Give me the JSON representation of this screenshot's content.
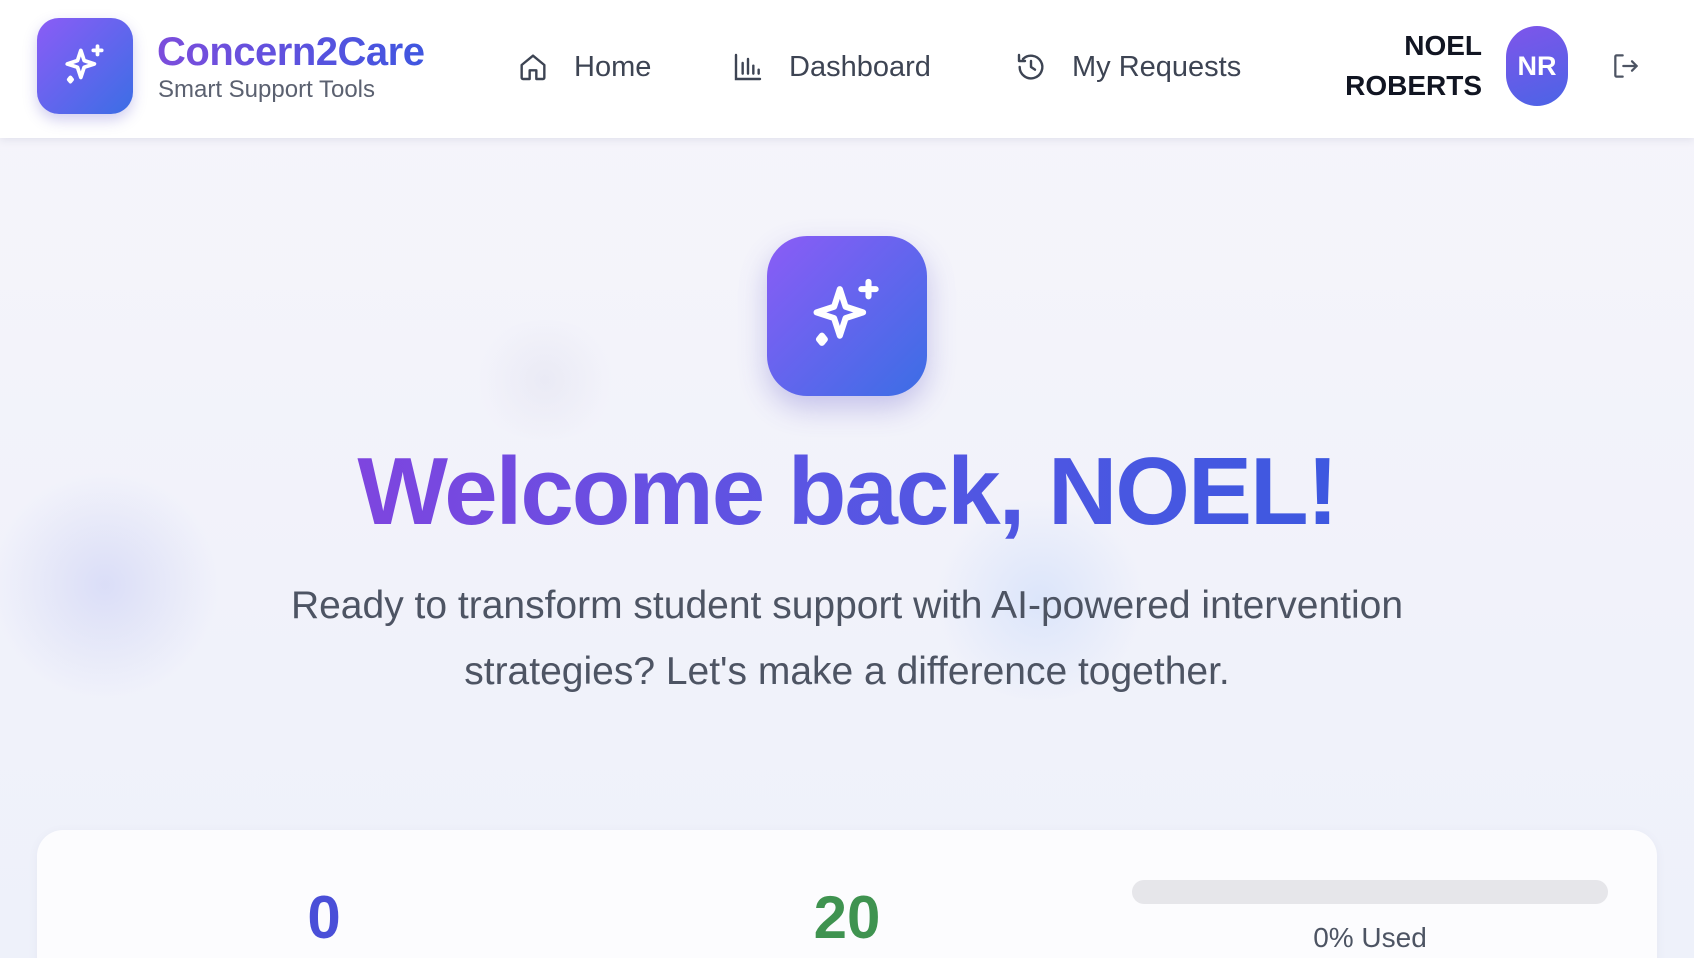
{
  "brand": {
    "title": "Concern2Care",
    "subtitle": "Smart Support Tools",
    "logo_icon": "sparkles-icon"
  },
  "nav": [
    {
      "label": "Home",
      "icon": "home-icon"
    },
    {
      "label": "Dashboard",
      "icon": "bar-chart-icon"
    },
    {
      "label": "My Requests",
      "icon": "history-icon"
    }
  ],
  "user": {
    "name_line1": "NOEL",
    "name_line2": "ROBERTS",
    "initials": "NR",
    "logout_icon": "logout-icon"
  },
  "hero": {
    "icon": "sparkles-icon",
    "title": "Welcome back, NOEL!",
    "subtitle": "Ready to transform student support with AI-powered intervention strategies? Let's make a difference together."
  },
  "stats": {
    "requests_used": "0",
    "requests_remaining": "20",
    "usage_fraction": 0,
    "usage_label": "0% Used"
  },
  "colors": {
    "brand_gradient_start": "#8b5cf6",
    "brand_gradient_end": "#3b6ee5",
    "stat_purple": "#4a4fd8",
    "stat_green": "#3f9350"
  }
}
